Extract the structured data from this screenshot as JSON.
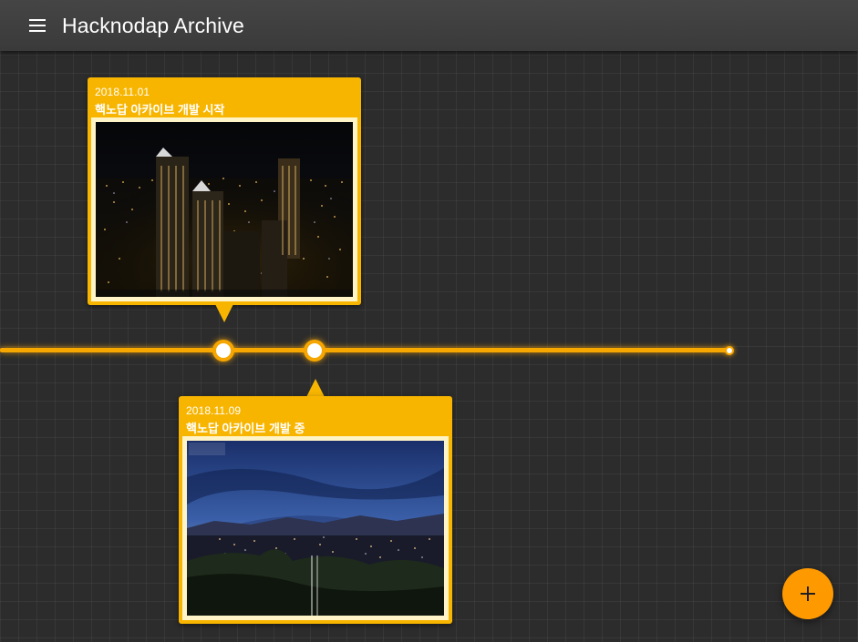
{
  "appbar": {
    "title": "Hacknodap Archive",
    "menu_icon": "menu-icon"
  },
  "timeline": {
    "events": [
      {
        "date": "2018.11.01",
        "title": "핵노답 아카이브 개발 시작",
        "image": "night-city-skyline-photo"
      },
      {
        "date": "2018.11.09",
        "title": "핵노답 아카이브 개발 중",
        "image": "dusk-city-panorama-photo"
      }
    ]
  },
  "fab": {
    "icon": "plus-icon"
  },
  "colors": {
    "accent": "#f7b500",
    "track": "#f7a800",
    "fab": "#ff9900",
    "appbar": "#3e3e3e",
    "background": "#2c2c2c"
  }
}
